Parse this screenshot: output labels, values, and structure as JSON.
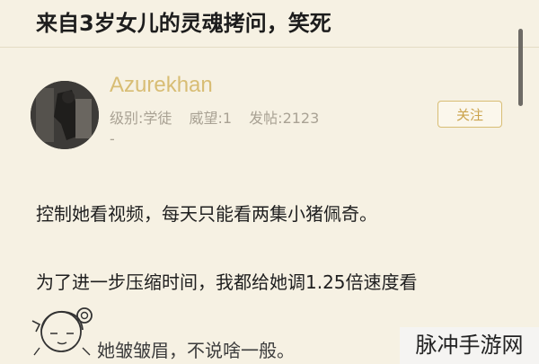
{
  "post": {
    "title": "来自3岁女儿的灵魂拷问，笑死"
  },
  "author": {
    "name": "Azurekhan",
    "level": "级别:学徒",
    "reputation": "威望:1",
    "posts": "发帖:2123",
    "dash": "-",
    "follow_label": "关注"
  },
  "body": {
    "paragraphs": [
      "控制她看视频，每天只能看两集小猪佩奇。",
      "为了进一步压缩时间，我都给她调1.25倍速度看",
      "她皱皱眉，不说啥一般。"
    ]
  },
  "watermark": "脉冲手游网"
}
